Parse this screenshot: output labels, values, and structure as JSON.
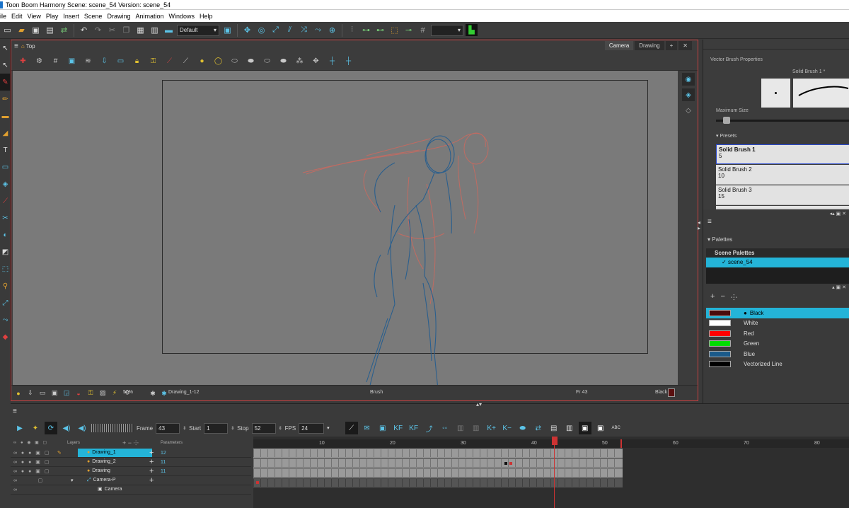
{
  "window": {
    "title": "Toon Boom Harmony Scene: scene_54 Version: scene_54"
  },
  "menu": [
    "ile",
    "Edit",
    "View",
    "Play",
    "Insert",
    "Scene",
    "Drawing",
    "Animation",
    "Windows",
    "Help"
  ],
  "toolbar": {
    "workspace": "Default"
  },
  "camera_view": {
    "breadcrumb": "Top",
    "tabs": [
      "Camera",
      "Drawing"
    ],
    "active_tab": "Camera",
    "status": {
      "zoom": "50%",
      "drawing": "Drawing_1-12",
      "tool": "Brush",
      "frame": "Fr 43",
      "color": "Black"
    }
  },
  "brush_props": {
    "title": "Vector Brush Properties",
    "brush_name": "Solid Brush 1 *",
    "max_size_label": "Maximum Size",
    "presets_label": "Presets",
    "presets": [
      {
        "name": "Solid Brush 1",
        "size": "5"
      },
      {
        "name": "Solid Brush 2",
        "size": "10"
      },
      {
        "name": "Solid Brush 3",
        "size": "15"
      }
    ]
  },
  "palettes": {
    "title": "Palettes",
    "scene_palettes_header": "Scene Palettes",
    "scene_palette": "scene_54",
    "colors": [
      {
        "name": "Black",
        "hex": "#4a0c0c"
      },
      {
        "name": "White",
        "hex": "#ffffff"
      },
      {
        "name": "Red",
        "hex": "#ff0000"
      },
      {
        "name": "Green",
        "hex": "#00dd00"
      },
      {
        "name": "Blue",
        "hex": "#1a5a8a"
      },
      {
        "name": "Vectorized Line",
        "hex": "#000000"
      }
    ]
  },
  "timeline": {
    "frame_label": "Frame",
    "frame": "43",
    "start_label": "Start",
    "start": "1",
    "stop_label": "Stop",
    "stop": "52",
    "fps_label": "FPS",
    "fps": "24",
    "layers_header": "Layers",
    "params_header": "Parameters",
    "layers": [
      {
        "name": "Drawing_1",
        "param": "12"
      },
      {
        "name": "Drawing_2",
        "param": "11"
      },
      {
        "name": "Drawing",
        "param": "11"
      },
      {
        "name": "Camera-P",
        "param": ""
      },
      {
        "name": "Camera",
        "param": ""
      }
    ],
    "ruler": [
      "10",
      "20",
      "30",
      "40",
      "50",
      "60",
      "70",
      "80"
    ]
  },
  "colors": {
    "accent": "#24b4d8",
    "sketch_blue": "#2a5f8e",
    "sketch_red": "#c86a60",
    "playhead": "#cc3333"
  }
}
